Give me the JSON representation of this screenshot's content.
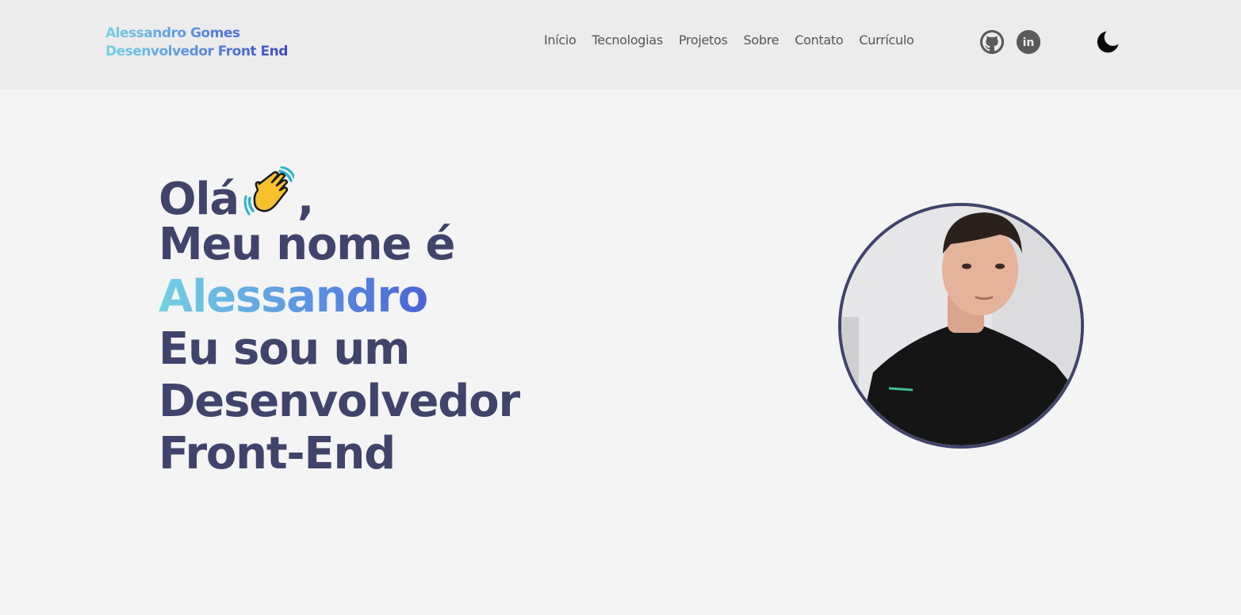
{
  "header": {
    "brand_name": "Alessandro Gomes",
    "brand_role": "Desenvolvedor Front End",
    "nav": [
      {
        "label": "Início"
      },
      {
        "label": "Tecnologias"
      },
      {
        "label": "Projetos"
      },
      {
        "label": "Sobre"
      },
      {
        "label": "Contato"
      },
      {
        "label": "Currículo"
      }
    ],
    "social_icons": [
      "github-icon",
      "linkedin-icon"
    ],
    "linkedin_glyph": "in",
    "theme_icon": "moon-icon"
  },
  "hero": {
    "greeting": "Olá",
    "greeting_emoji": "waving-hand-icon",
    "greeting_suffix": ",",
    "line2": "Meu nome é",
    "name": "Alessandro",
    "line4": "Eu sou um",
    "line5": "Desenvolvedor",
    "line6": "Front-End"
  },
  "colors": {
    "heading": "#40436b",
    "gradient_start": "#74d1e3",
    "gradient_end": "#3b3fc6",
    "header_bg": "#ececec",
    "page_bg": "#f4f4f5"
  }
}
